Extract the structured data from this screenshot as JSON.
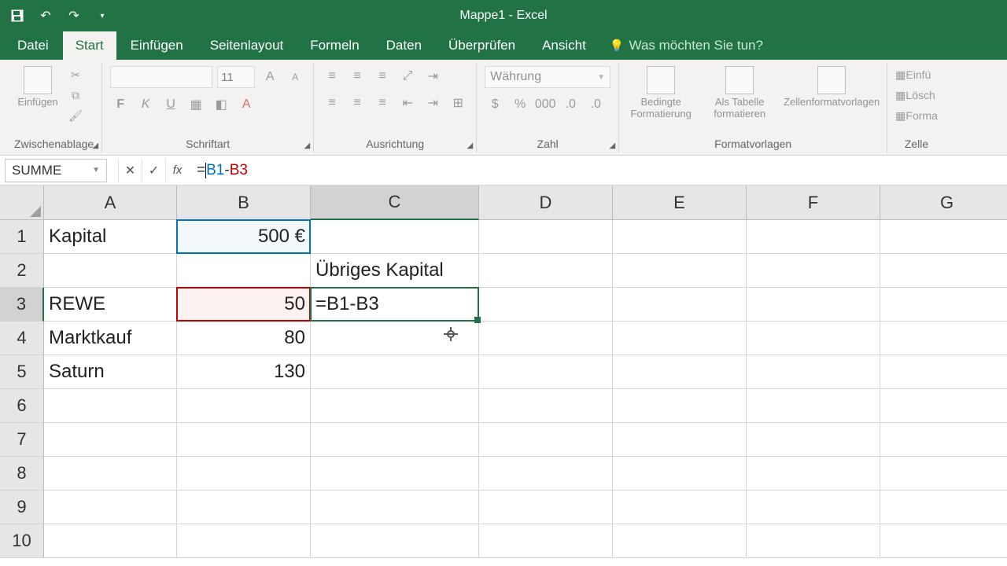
{
  "window": {
    "title": "Mappe1 - Excel"
  },
  "qat": {
    "undo": "↶",
    "redo": "↷",
    "more": "▾"
  },
  "tabs": {
    "file": "Datei",
    "home": "Start",
    "insert": "Einfügen",
    "layout": "Seitenlayout",
    "formulas": "Formeln",
    "data": "Daten",
    "review": "Überprüfen",
    "view": "Ansicht",
    "tellme": "Was möchten Sie tun?"
  },
  "ribbon": {
    "clipboard": {
      "paste": "Einfügen",
      "label": "Zwischenablage"
    },
    "font": {
      "size": "11",
      "label": "Schriftart",
      "bold": "F",
      "italic": "K",
      "underline": "U"
    },
    "alignment": {
      "label": "Ausrichtung"
    },
    "number": {
      "format": "Währung",
      "label": "Zahl"
    },
    "styles": {
      "cond": "Bedingte Formatierung",
      "table": "Als Tabelle formatieren",
      "cellstyles": "Zellenformatvorlagen",
      "label": "Formatvorlagen"
    },
    "cells": {
      "insert": "Einfü",
      "delete": "Lösch",
      "format": "Forma",
      "label": "Zelle"
    }
  },
  "formula_bar": {
    "name": "SUMME",
    "eq": "=",
    "ref1": "B1",
    "op": "-",
    "ref2": "B3"
  },
  "columns": [
    "A",
    "B",
    "C",
    "D",
    "E",
    "F",
    "G"
  ],
  "rows": [
    "1",
    "2",
    "3",
    "4",
    "5",
    "6",
    "7",
    "8",
    "9",
    "10"
  ],
  "sheet": {
    "a1": "Kapital",
    "b1": "500 €",
    "c2": "Übriges Kapital",
    "a3": "REWE",
    "b3": "50",
    "c3": "=B1-B3",
    "a4": "Marktkauf",
    "b4": "80",
    "a5": "Saturn",
    "b5": "130"
  },
  "active_cell": "C3",
  "selected_column": "C",
  "selected_row": "3"
}
